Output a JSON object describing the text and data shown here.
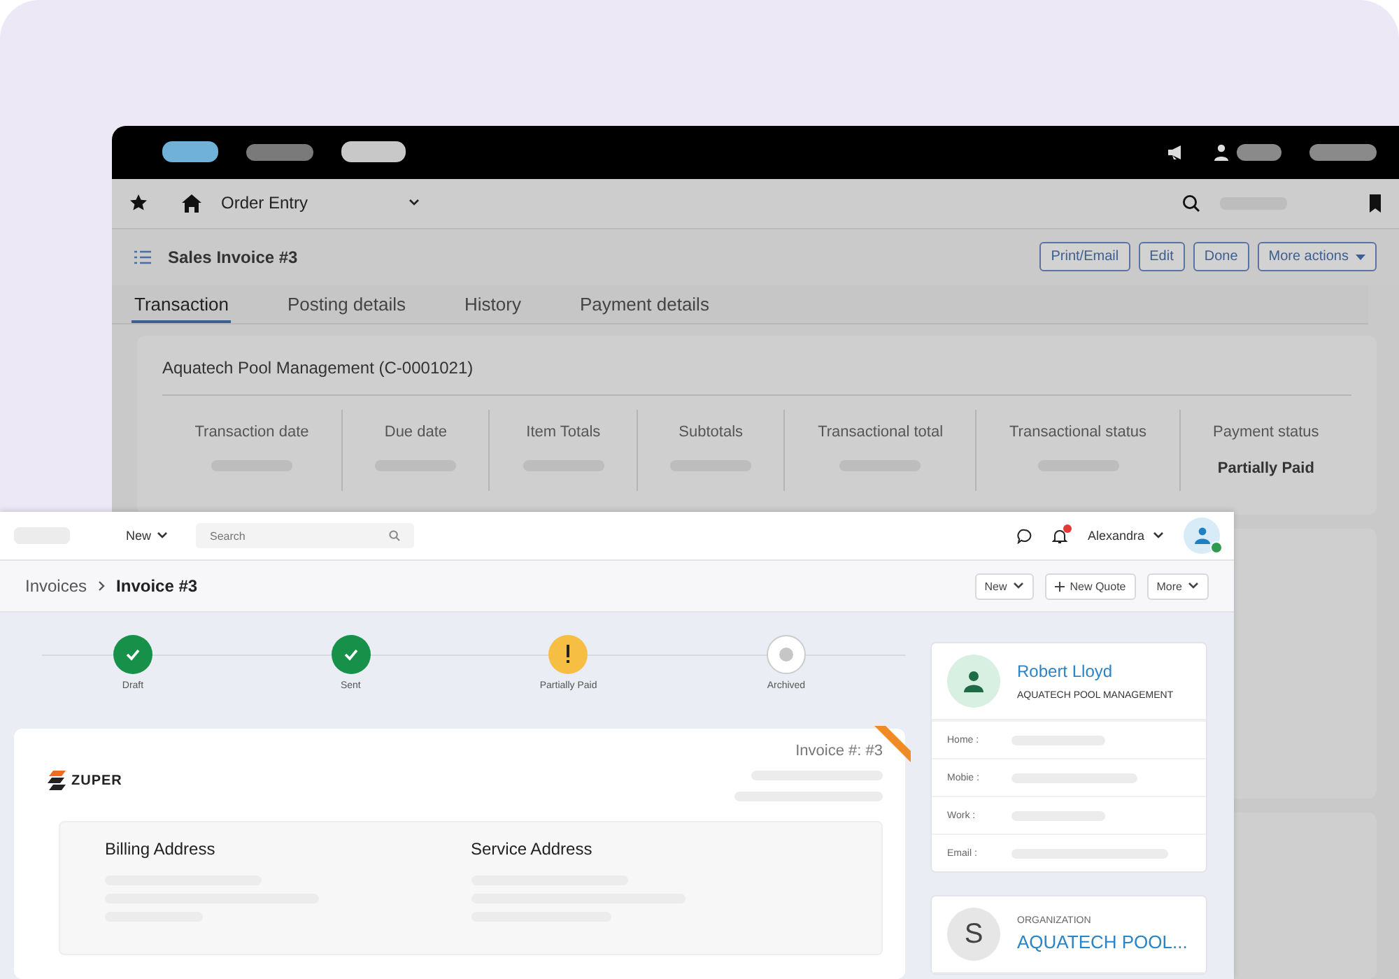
{
  "back_window": {
    "toolbar": {
      "module": "Order Entry"
    },
    "header": {
      "title": "Sales Invoice #3",
      "buttons": [
        {
          "label": "Print/Email",
          "kind": "plain"
        },
        {
          "label": "Edit",
          "kind": "plain"
        },
        {
          "label": "Done",
          "kind": "plain"
        },
        {
          "label": "More actions",
          "kind": "dropdown"
        }
      ]
    },
    "tabs": [
      {
        "label": "Transaction",
        "selected": true
      },
      {
        "label": "Posting details",
        "selected": false
      },
      {
        "label": "History",
        "selected": false
      },
      {
        "label": "Payment details",
        "selected": false
      }
    ],
    "summary": {
      "customer": "Aquatech Pool Management (C-0001021)",
      "columns": [
        {
          "label": "Transaction date"
        },
        {
          "label": "Due date"
        },
        {
          "label": "Item Totals"
        },
        {
          "label": "Subtotals"
        },
        {
          "label": "Transactional total"
        },
        {
          "label": "Transactional status"
        },
        {
          "label": "Payment status",
          "value": "Partially Paid"
        }
      ]
    }
  },
  "front_window": {
    "nav": {
      "menu": "New",
      "search": {
        "placeholder": "Search"
      },
      "user": "Alexandra"
    },
    "breadcrumb": [
      "Invoices",
      "Invoice #3"
    ],
    "actions": [
      {
        "label": "New",
        "kind": "dropdown"
      },
      {
        "label": "New Quote",
        "kind": "add"
      },
      {
        "label": "More",
        "kind": "dropdown"
      }
    ],
    "steps": [
      {
        "label": "Draft",
        "kind": "done"
      },
      {
        "label": "Sent",
        "kind": "done"
      },
      {
        "label": "Partially Paid",
        "kind": "attention"
      },
      {
        "label": "Archived",
        "kind": "pending"
      }
    ],
    "invoice": {
      "number": "Invoice #: #3",
      "brand": "ZUPER",
      "addresses": [
        {
          "title": "Billing Address"
        },
        {
          "title": "Service Address"
        }
      ]
    },
    "contact": {
      "name": "Robert Lloyd",
      "company": "AQUATECH POOL MANAGEMENT",
      "fields": [
        "Home :",
        "Mobie :",
        "Work :",
        "Email :"
      ]
    },
    "organization": {
      "label": "ORGANIZATION",
      "initial": "S",
      "name": "AQUATECH POOL..."
    }
  }
}
